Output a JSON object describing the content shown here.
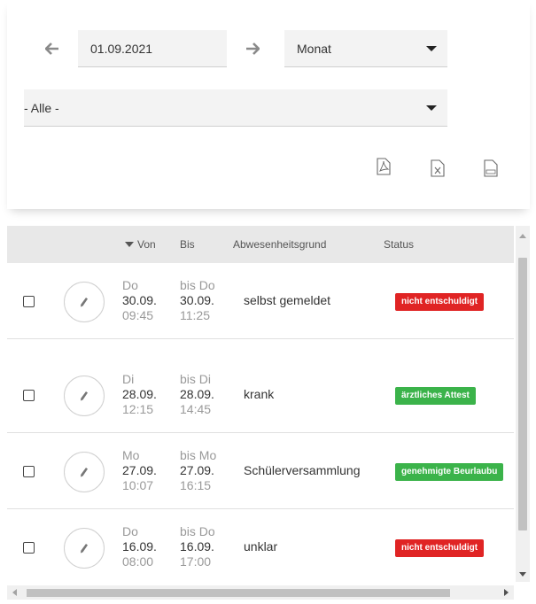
{
  "filters": {
    "date": "01.09.2021",
    "period": "Monat",
    "class_filter": "- Alle -"
  },
  "exports": [
    {
      "icon": "pdf-icon",
      "label": "PDF"
    },
    {
      "icon": "excel-icon",
      "label": "X"
    },
    {
      "icon": "csv-icon",
      "label": "csv"
    }
  ],
  "table": {
    "headers": {
      "from": "Von",
      "to": "Bis",
      "reason": "Abwesenheitsgrund",
      "status": "Status"
    },
    "rows": [
      {
        "from_day": "Do",
        "from_date": "30.09.",
        "from_time": "09:45",
        "to_day": "bis Do",
        "to_date": "30.09.",
        "to_time": "11:25",
        "reason": "selbst gemeldet",
        "status": "nicht entschuldigt",
        "status_color": "#e02424"
      },
      {
        "from_day": "Di",
        "from_date": "28.09.",
        "from_time": "12:15",
        "to_day": "bis Di",
        "to_date": "28.09.",
        "to_time": "14:45",
        "reason": "krank",
        "status": "ärztliches Attest",
        "status_color": "#3bb34a"
      },
      {
        "from_day": "Mo",
        "from_date": "27.09.",
        "from_time": "10:07",
        "to_day": "bis Mo",
        "to_date": "27.09.",
        "to_time": "16:15",
        "reason": "Schülerversammlung",
        "status": "genehmigte Beurlaubu",
        "status_color": "#3bb34a"
      },
      {
        "from_day": "Do",
        "from_date": "16.09.",
        "from_time": "08:00",
        "to_day": "bis Do",
        "to_date": "16.09.",
        "to_time": "17:00",
        "reason": "unklar",
        "status": "nicht entschuldigt",
        "status_color": "#e02424"
      }
    ]
  }
}
